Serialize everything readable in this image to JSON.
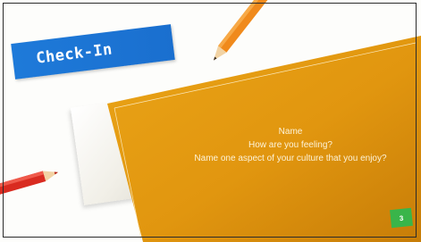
{
  "slide": {
    "title": "Check-In",
    "body_lines": [
      "Name",
      "How are you feeling?",
      "Name one aspect of your culture that you enjoy?"
    ],
    "slide_number": "3"
  },
  "colors": {
    "banner_blue": "#1e7ad9",
    "sheet_orange": "#e39a12",
    "sheet_orange_dark": "#c77d08",
    "number_badge_green": "#39b54a",
    "body_text": "#fdf3d8"
  },
  "decorations": [
    "orange-pencil-icon",
    "red-pencil-icon",
    "paper-sheet"
  ]
}
